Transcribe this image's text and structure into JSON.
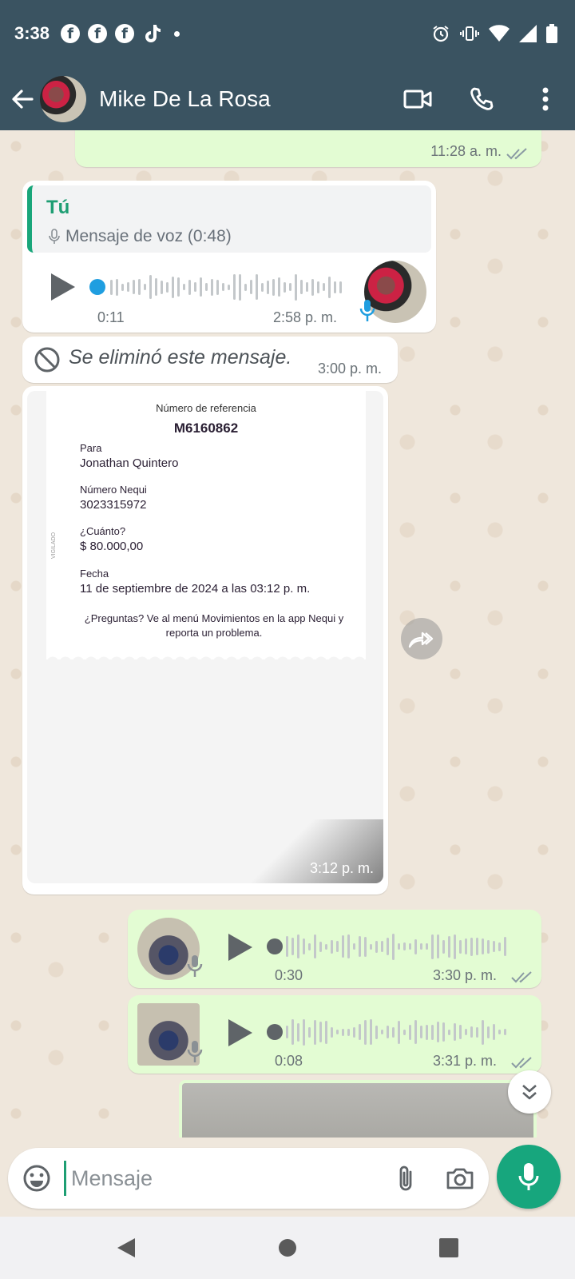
{
  "status_bar": {
    "time": "3:38"
  },
  "header": {
    "contact_name": "Mike De La Rosa"
  },
  "messages": {
    "m0": {
      "time": "11:28 a. m."
    },
    "m1": {
      "reply_author": "Tú",
      "reply_text": "Mensaje de voz (0:48)",
      "duration": "0:11",
      "time": "2:58 p. m."
    },
    "m2": {
      "text": "Se eliminó este mensaje.",
      "time": "3:00 p. m."
    },
    "m3": {
      "time": "3:12 p. m.",
      "receipt": {
        "ref_label": "Número de referencia",
        "ref": "M6160862",
        "to_label": "Para",
        "to": "Jonathan Quintero",
        "nequi_label": "Número Nequi",
        "nequi": "3023315972",
        "amount_label": "¿Cuánto?",
        "amount": "$ 80.000,00",
        "date_label": "Fecha",
        "date": "11 de septiembre de 2024 a las 03:12 p. m.",
        "footer": "¿Preguntas? Ve al menú Movimientos en la app Nequi y reporta un problema.",
        "vigilado": "VIGILADO"
      }
    },
    "m4": {
      "duration": "0:30",
      "time": "3:30 p. m."
    },
    "m5": {
      "duration": "0:08",
      "time": "3:31 p. m."
    }
  },
  "composer": {
    "placeholder": "Mensaje"
  },
  "colors": {
    "header_bg": "#3a5361",
    "outgoing_bubble": "#e3fcd3",
    "accent_green": "#17a67d",
    "seek_blue": "#1f9ee0",
    "read_ticks": "#8a9aa3"
  },
  "icons": [
    "back-arrow-icon",
    "video-call-icon",
    "phone-icon",
    "more-vert-icon",
    "play-icon",
    "mic-icon",
    "blocked-icon",
    "forward-icon",
    "chevron-double-down-icon",
    "emoji-icon",
    "attach-icon",
    "camera-icon"
  ]
}
